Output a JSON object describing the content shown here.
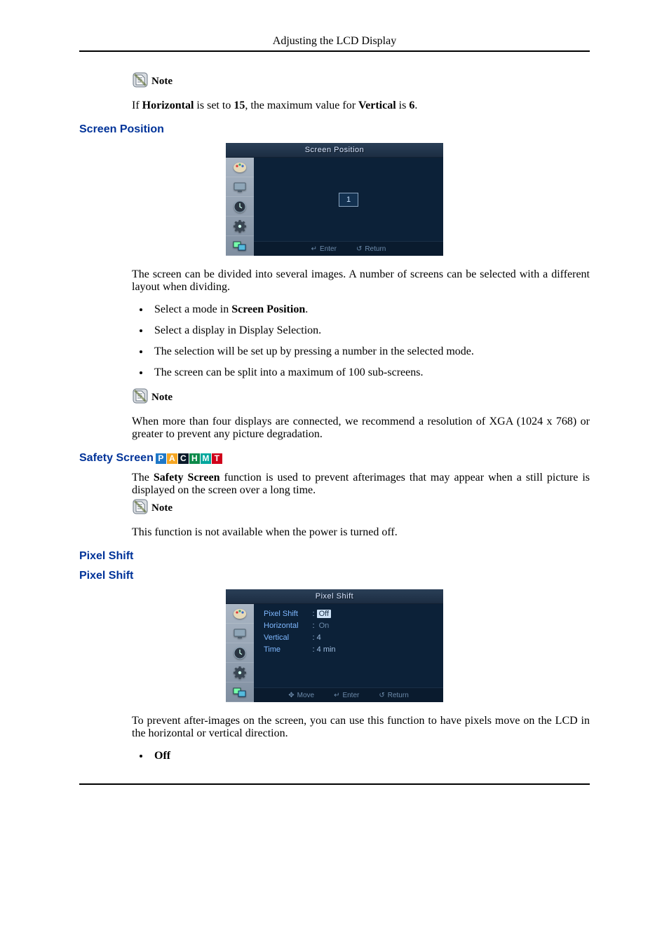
{
  "header": {
    "title": "Adjusting the LCD Display"
  },
  "note_label": "Note",
  "note1_text_parts": {
    "p1": "If ",
    "b1": "Horizontal",
    "p2": " is set to ",
    "b2": "15",
    "p3": ", the maximum value for ",
    "b3": "Vertical",
    "p4": " is ",
    "b4": "6",
    "p5": "."
  },
  "screen_position": {
    "heading": "Screen Position",
    "osd": {
      "title": "Screen Position",
      "selected": "1",
      "foot_enter_icon": "↵",
      "foot_enter": "Enter",
      "foot_return_icon": "↺",
      "foot_return": "Return"
    },
    "para": "The screen can be divided into several images. A number of screens can be selected with a different layout when dividing.",
    "bullets": [
      {
        "pre": "Select a mode in ",
        "bold": "Screen Position",
        "post": "."
      },
      {
        "pre": "Select a display in Display Selection.",
        "bold": "",
        "post": ""
      },
      {
        "pre": "The selection will be set up by pressing a number in the selected mode.",
        "bold": "",
        "post": ""
      },
      {
        "pre": "The screen can be split into a maximum of 100 sub-screens.",
        "bold": "",
        "post": ""
      }
    ],
    "note_text": "When more than four displays are connected, we recommend a resolution of XGA (1024 x 768) or greater to prevent any picture degradation."
  },
  "safety_screen": {
    "heading": "Safety Screen",
    "badges": [
      "P",
      "A",
      "C",
      "H",
      "M",
      "T"
    ],
    "para_parts": {
      "p1": "The ",
      "b1": "Safety Screen",
      "p2": " function is used to prevent afterimages that may appear when a still picture is displayed on the screen over a long time."
    },
    "note_text": "This function is not available when the power is turned off."
  },
  "pixel_shift": {
    "heading1": "Pixel Shift",
    "heading2": "Pixel Shift",
    "osd": {
      "title": "Pixel Shift",
      "labels": [
        "Pixel Shift",
        "Horizontal",
        "Vertical",
        "Time"
      ],
      "values_display": {
        "v0_hl": "Off",
        "v1_dim": "On",
        "v2": ": 4",
        "v3": ": 4 min"
      },
      "foot_move_icon": "✥",
      "foot_move": "Move",
      "foot_enter_icon": "↵",
      "foot_enter": "Enter",
      "foot_return_icon": "↺",
      "foot_return": "Return"
    },
    "para": "To prevent after-images on the screen, you can use this function to have pixels move on the LCD in the horizontal or vertical direction.",
    "bullets": [
      {
        "bold": "Off"
      }
    ]
  },
  "icons": {
    "note": "note-icon",
    "side": [
      "palette-icon",
      "screen-icon",
      "clock-icon",
      "gear-icon",
      "multi-icon"
    ]
  }
}
